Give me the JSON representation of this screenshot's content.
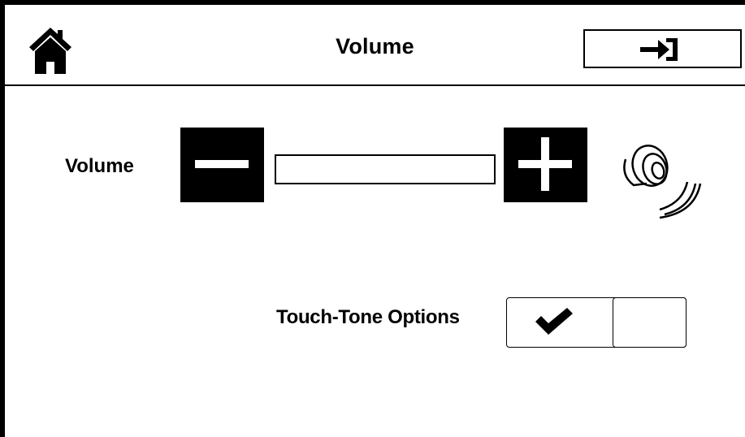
{
  "header": {
    "title": "Volume",
    "home_icon": "home-icon",
    "exit_icon": "sign-in-arrow-icon"
  },
  "volume": {
    "label": "Volume",
    "decrease_icon": "minus-icon",
    "increase_icon": "plus-icon",
    "level": 0,
    "speaker_icon": "speaker-icon"
  },
  "touch_tone": {
    "label": "Touch-Tone Options",
    "on_icon": "checkmark-icon",
    "selected": "on"
  },
  "colors": {
    "foreground": "#000000",
    "background": "#ffffff"
  }
}
